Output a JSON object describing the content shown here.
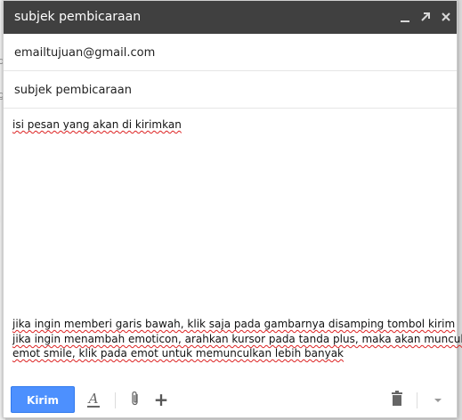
{
  "compose": {
    "title": "subjek pembicaraan",
    "to_value": "emailtujuan@gmail.com",
    "subject_value": "subjek pembicaraan",
    "body_lines": [
      "isi pesan yang akan di kirimkan",
      "jika ingin memberi garis bawah, klik saja pada gambarnya disamping tombol kirim",
      "jika ingin menambah emoticon, arahkan kursor pada tanda plus, maka akan muncul",
      "emot smile, klik pada emot untuk memunculkan lebih banyak"
    ],
    "send_label": "Kirim"
  },
  "colors": {
    "titlebar": "#404040",
    "send_button": "#4d90fe",
    "spellcheck_underline": "#dd2222"
  },
  "icons": {
    "minimize": "minimize-icon",
    "popout": "popout-icon",
    "close": "close-icon",
    "format": "text-format-icon",
    "attach": "paperclip-icon",
    "more_options": "plus-icon",
    "discard": "trash-icon",
    "menu": "chevron-down-icon"
  }
}
